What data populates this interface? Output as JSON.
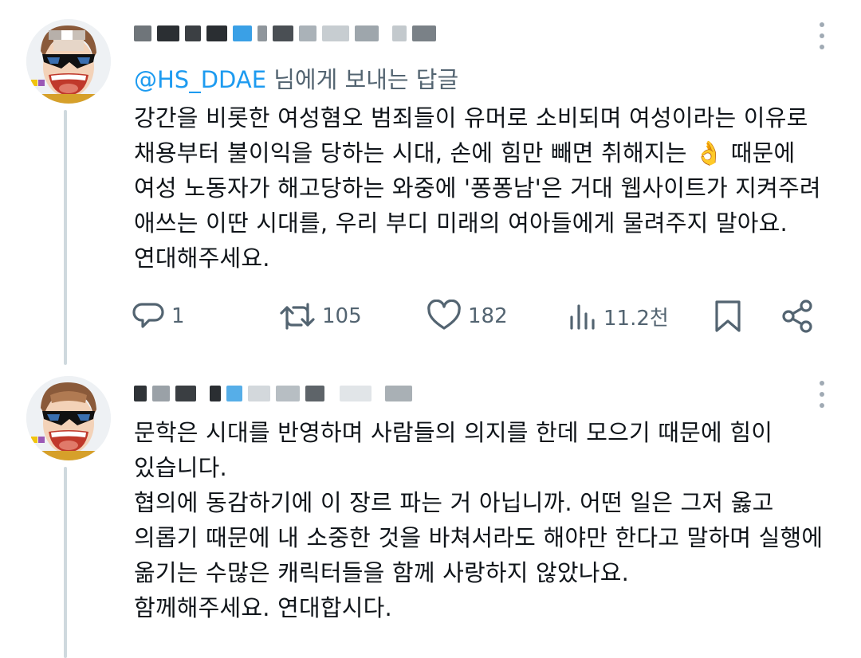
{
  "tweets": [
    {
      "reply_prefix": "@HS_DDAE",
      "reply_suffix": " 님에게 보내는 답글",
      "text": "강간을 비롯한 여성혐오 범죄들이 유머로 소비되며 여성이라는 이유로\n채용부터 불이익을 당하는 시대, 손에 힘만 빼면 취해지는 👌 때문에\n여성 노동자가 해고당하는 와중에 '퐁퐁남'은 거대 웹사이트가 지켜주려\n애쓰는 이딴 시대를, 우리 부디 미래의 여아들에게 물려주지 말아요.\n연대해주세요.",
      "metrics": {
        "replies": "1",
        "retweets": "105",
        "likes": "182",
        "views": "11.2천"
      },
      "icons": [
        "reply-icon",
        "retweet-icon",
        "heart-icon",
        "views-icon",
        "bookmark-icon",
        "share-icon"
      ]
    },
    {
      "text": "문학은 시대를 반영하며 사람들의 의지를 한데 모으기 때문에 힘이\n있습니다.\n협의에 동감하기에 이 장르 파는 거 아닙니까. 어떤 일은 그저 옳고\n의롭기 때문에 내 소중한 것을 바쳐서라도 해야만 한다고 말하며 실행에\n옮기는 수많은 캐릭터들을 함께 사랑하지 않았나요.\n함께해주세요. 연대합시다."
    }
  ],
  "colors": {
    "accent": "#1d9bf0",
    "muted": "#536471",
    "text": "#0f1419",
    "thread_line": "#cfd9de"
  }
}
